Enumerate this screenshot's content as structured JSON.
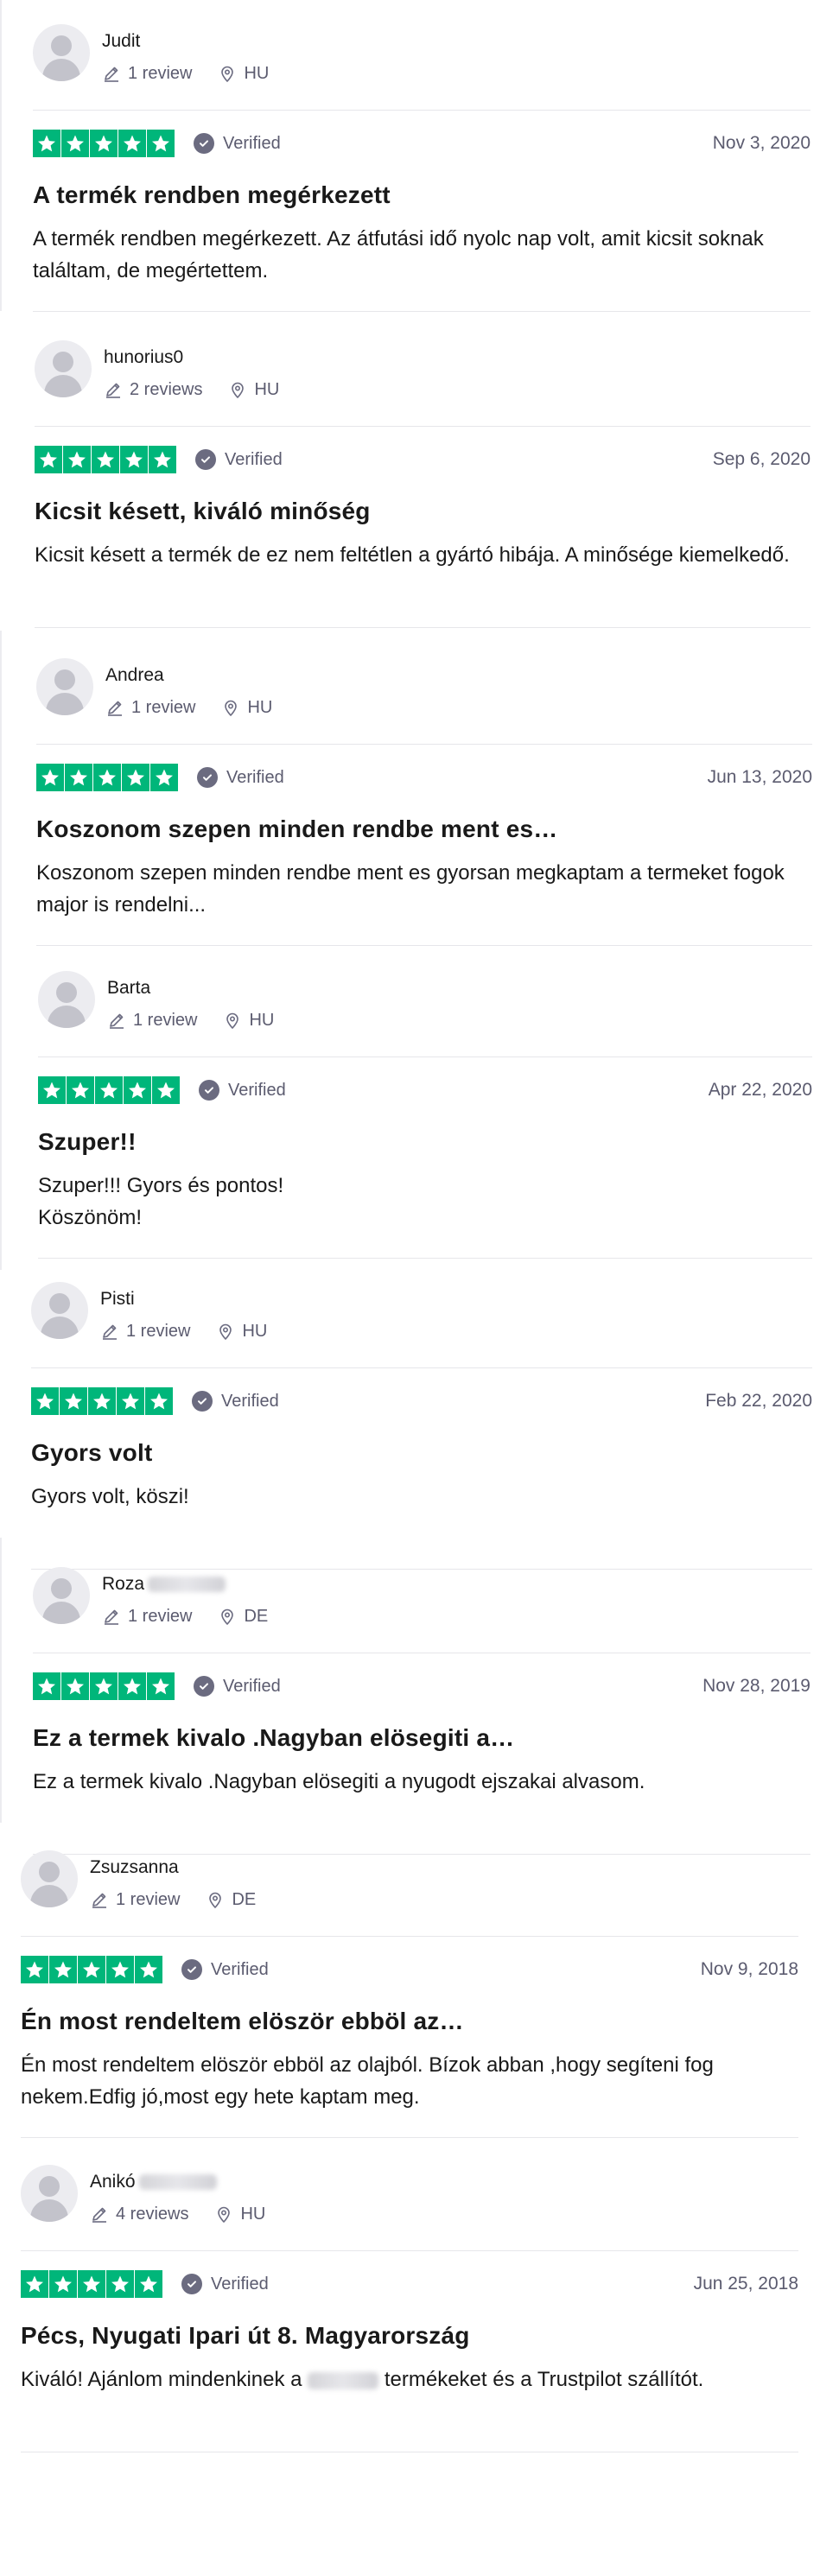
{
  "colors": {
    "star_green": "#00b67a",
    "muted_text": "#5b5b6f",
    "divider": "#e6e6ea"
  },
  "icons": {
    "review_count": "pencil-icon",
    "location": "location-pin-icon",
    "verified": "checkmark-circle-icon",
    "star": "star-icon",
    "avatar": "user-avatar-icon"
  },
  "reviews": [
    {
      "name": "Judit",
      "reviews": "1 review",
      "country": "HU",
      "rating": 5,
      "verified": "Verified",
      "date": "Nov 3, 2020",
      "title": "A termék rendben megérkezett",
      "body": "A termék rendben megérkezett. Az átfutási idő nyolc nap volt, amit kicsit soknak találtam, de megértettem."
    },
    {
      "name": "hunorius0",
      "reviews": "2 reviews",
      "country": "HU",
      "rating": 5,
      "verified": "Verified",
      "date": "Sep 6, 2020",
      "title": "Kicsit késett, kiváló minőség",
      "body": "Kicsit késett a termék de ez nem feltétlen a gyártó hibája. A minősége kiemelkedő."
    },
    {
      "name": "Andrea",
      "reviews": "1 review",
      "country": "HU",
      "rating": 5,
      "verified": "Verified",
      "date": "Jun 13, 2020",
      "title": "Koszonom szepen minden rendbe ment es…",
      "body": "Koszonom szepen minden rendbe ment es gyorsan megkaptam a termeket fogok major is rendelni..."
    },
    {
      "name": "Barta",
      "reviews": "1 review",
      "country": "HU",
      "rating": 5,
      "verified": "Verified",
      "date": "Apr 22, 2020",
      "title": "Szuper!!",
      "body": "Szuper!!! Gyors és pontos!\nKöszönöm!"
    },
    {
      "name": "Pisti",
      "reviews": "1 review",
      "country": "HU",
      "rating": 5,
      "verified": "Verified",
      "date": "Feb 22, 2020",
      "title": "Gyors volt",
      "body": "Gyors volt, köszi!"
    },
    {
      "name": "Roza",
      "reviews": "1 review",
      "country": "DE",
      "rating": 5,
      "verified": "Verified",
      "date": "Nov 28, 2019",
      "title": "Ez a termek kivalo .Nagyban elösegiti a…",
      "body": "Ez a termek kivalo .Nagyban elösegiti a nyugodt ejszakai alvasom."
    },
    {
      "name": "Zsuzsanna",
      "reviews": "1 review",
      "country": "DE",
      "rating": 5,
      "verified": "Verified",
      "date": "Nov 9, 2018",
      "title": "Én most rendeltem elöször ebböl az…",
      "body": "Én most rendeltem elöször ebböl az olajból. Bízok abban ,hogy segíteni fog nekem.Edfig jó,most egy hete kaptam meg."
    },
    {
      "name": "Anikó",
      "reviews": "4 reviews",
      "country": "HU",
      "rating": 5,
      "verified": "Verified",
      "date": "Jun 25, 2018",
      "title": "Pécs, Nyugati Ipari út 8. Magyarország",
      "body_before": "Kiváló! Ajánlom mindenkinek a ",
      "body_after": " termékeket és a Trustpilot szállítót."
    }
  ]
}
